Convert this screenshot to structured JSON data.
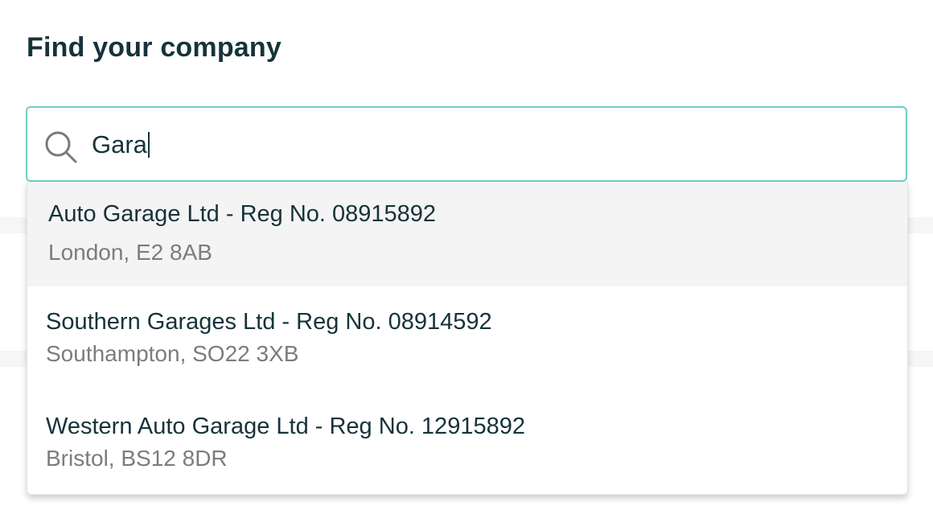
{
  "heading": "Find your company",
  "search": {
    "value": "Gara",
    "icon": "search-icon"
  },
  "colors": {
    "input_border": "#6fcdc4",
    "heading_text": "#16333a",
    "address_text": "#7c7c7c",
    "hover_row": "#f4f4f4"
  },
  "results": [
    {
      "name": "Auto Garage Ltd - Reg No. 08915892",
      "address": "London, E2 8AB"
    },
    {
      "name": "Southern Garages Ltd - Reg No. 08914592",
      "address": "Southampton, SO22 3XB"
    },
    {
      "name": "Western Auto Garage Ltd - Reg No. 12915892",
      "address": "Bristol, BS12 8DR"
    }
  ]
}
